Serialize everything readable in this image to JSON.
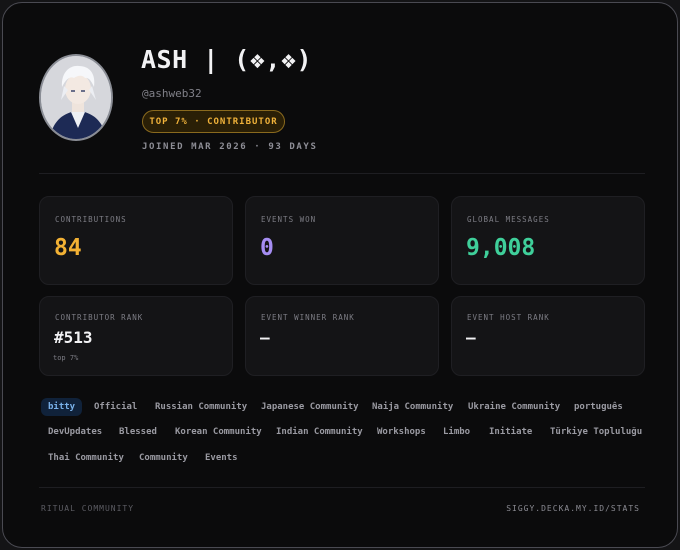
{
  "profile": {
    "name": "ASH | (❖,❖)",
    "handle": "@ashweb32",
    "badge": "TOP 7% · CONTRIBUTOR",
    "joined": "JOINED MAR 2026 · 93 DAYS"
  },
  "stats": [
    {
      "label": "CONTRIBUTIONS",
      "value": "84",
      "color": "#f2b134"
    },
    {
      "label": "EVENTS WON",
      "value": "0",
      "color": "#a58df2"
    },
    {
      "label": "GLOBAL MESSAGES",
      "value": "9,008",
      "color": "#3fcf9a"
    }
  ],
  "ranks": [
    {
      "label": "CONTRIBUTOR RANK",
      "value": "#513",
      "sub": "top 7%"
    },
    {
      "label": "EVENT WINNER RANK",
      "value": "—"
    },
    {
      "label": "EVENT HOST RANK",
      "value": "—"
    }
  ],
  "tags": [
    "bitty",
    "Official",
    "Russian Community",
    "Japanese Community",
    "Naija Community",
    "Ukraine Community",
    "português",
    "DevUpdates",
    "Blessed",
    "Korean Community",
    "Indian Community",
    "Workshops",
    "Limbo",
    "Initiate",
    "Türkiye Topluluğu",
    "Thai Community",
    "Community",
    "Events"
  ],
  "footer": {
    "left": "RITUAL COMMUNITY",
    "right": "SIGGY.DECKA.MY.ID/STATS"
  }
}
